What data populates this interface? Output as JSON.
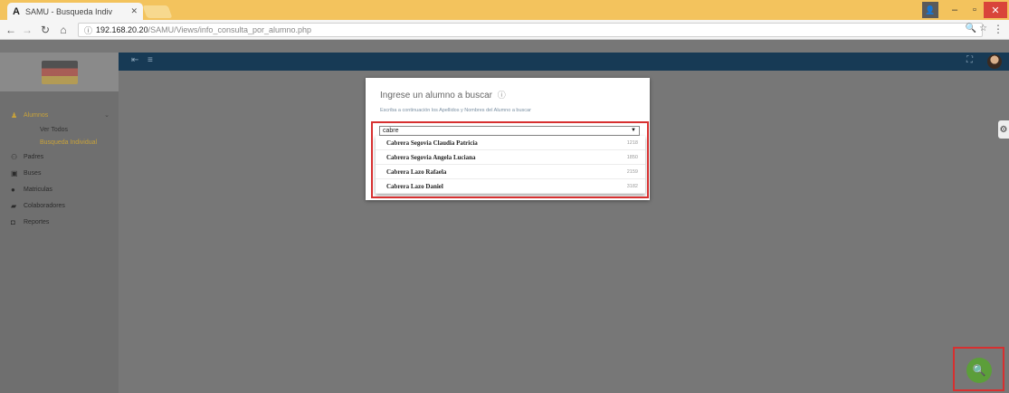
{
  "browser": {
    "tab_title": "SAMU - Busqueda Indiv",
    "tab_favicon": "A",
    "tab_close": "✕",
    "url_host": "192.168.20.20",
    "url_path": "/SAMU/Views/info_consulta_por_alumno.php",
    "url_right_icons": "🔍 ☆",
    "menu_dots": "⋮"
  },
  "sidebar": {
    "items": [
      {
        "label": "Alumnos",
        "icon": "person-icon",
        "glyph": "♟",
        "active": true,
        "caret": "⌄"
      },
      {
        "label": "Padres",
        "icon": "people-icon",
        "glyph": "⚇",
        "active": false
      },
      {
        "label": "Buses",
        "icon": "bus-icon",
        "glyph": "▣",
        "active": false
      },
      {
        "label": "Matriculas",
        "icon": "circle-icon",
        "glyph": "●",
        "active": false
      },
      {
        "label": "Colaboradores",
        "icon": "briefcase-icon",
        "glyph": "▰",
        "active": false
      },
      {
        "label": "Reportes",
        "icon": "report-icon",
        "glyph": "◘",
        "active": false
      }
    ],
    "subitems": [
      "Ver Todos",
      "Busqueda Individual"
    ]
  },
  "topbar": {
    "back_glyph": "⇤",
    "menu_glyph": "≡",
    "expand_glyph": "⛶"
  },
  "modal": {
    "title": "Ingrese un alumno a buscar",
    "help_glyph": "ⓘ",
    "hint": "Escriba a continuación los Apellidos y Nombres del Alumno a buscar",
    "search_value": "cabre",
    "arrow_glyph": "▼"
  },
  "results": [
    {
      "name": "Cabrera Segovia Claudia Patricia",
      "code": "1218"
    },
    {
      "name": "Cabrera Segovia Angela Luciana",
      "code": "1850"
    },
    {
      "name": "Cabrera Lazo Rafaela",
      "code": "2159"
    },
    {
      "name": "Cabrera Lazo Daniel",
      "code": "3182"
    }
  ],
  "fab": {
    "glyph": "🔍"
  },
  "colors": {
    "accent": "#c8a23a",
    "topbar": "#173a55",
    "fab": "#5c9e3a",
    "highlight": "#d73030"
  }
}
